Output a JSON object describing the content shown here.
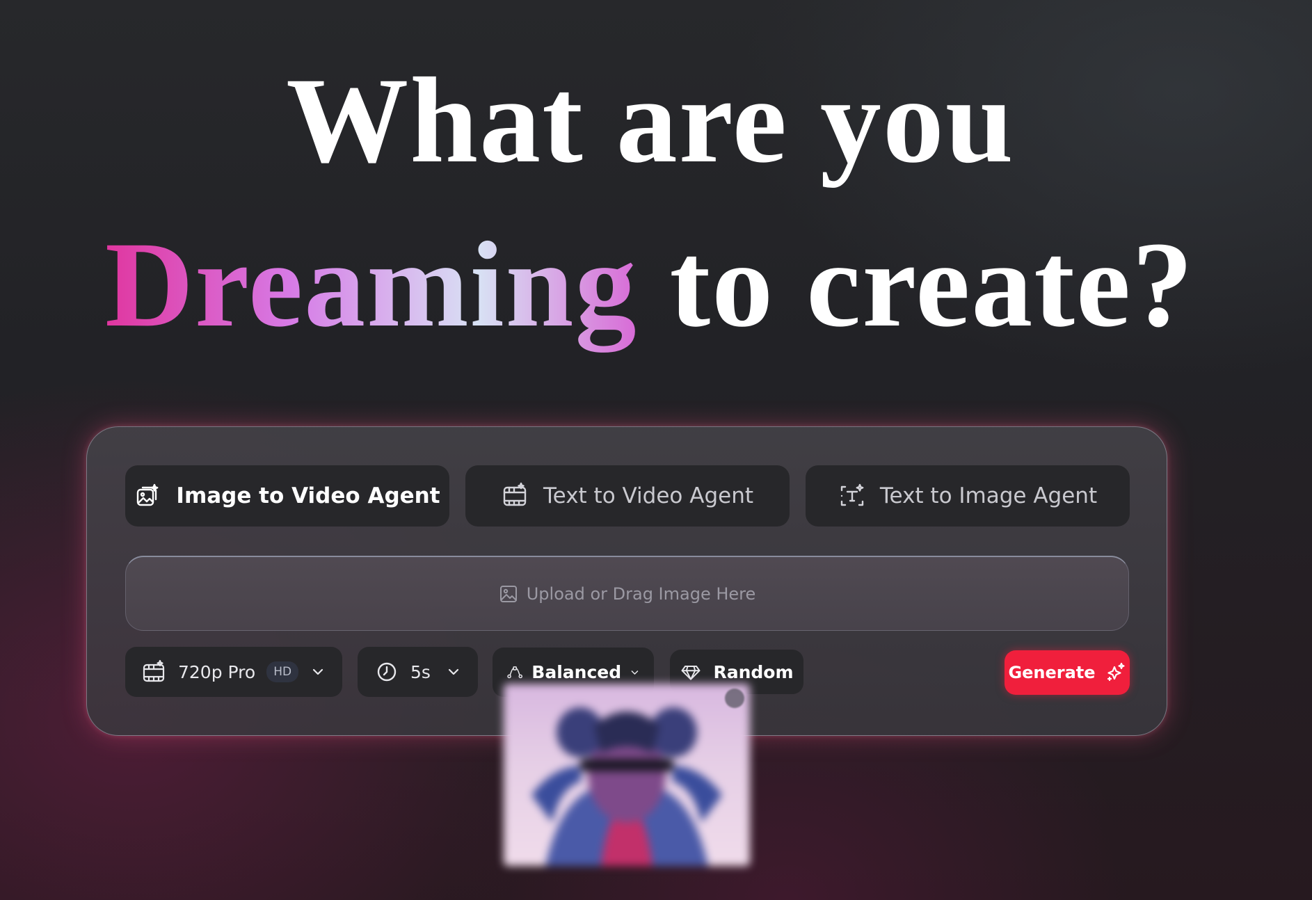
{
  "headline": {
    "line1": "What are you",
    "highlight": "Dreaming",
    "line2_rest": " to create?"
  },
  "tabs": [
    {
      "label": "Image to Video Agent",
      "icon": "image-sparkle-icon",
      "active": true
    },
    {
      "label": "Text to Video Agent",
      "icon": "video-sparkle-icon",
      "active": false
    },
    {
      "label": "Text to Image Agent",
      "icon": "text-frame-icon",
      "active": false
    }
  ],
  "upload": {
    "label": "Upload or Drag Image Here",
    "icon": "image-icon"
  },
  "controls": {
    "resolution": {
      "value": "720p Pro",
      "badge": "HD",
      "icon": "film-sparkle-icon"
    },
    "duration": {
      "value": "5s",
      "icon": "clock-icon"
    },
    "mode": {
      "value": "Balanced",
      "icon": "curve-icon"
    },
    "seed": {
      "value": "Random",
      "icon": "diamond-icon"
    }
  },
  "generate": {
    "label": "Generate",
    "icon": "sparkles-icon"
  },
  "colors": {
    "accent": "#f01f3c",
    "panel_glow": "#e25078",
    "highlight_gradient": [
      "#e0369f",
      "#d77be6",
      "#d8e2f4",
      "#d86ad6"
    ]
  }
}
